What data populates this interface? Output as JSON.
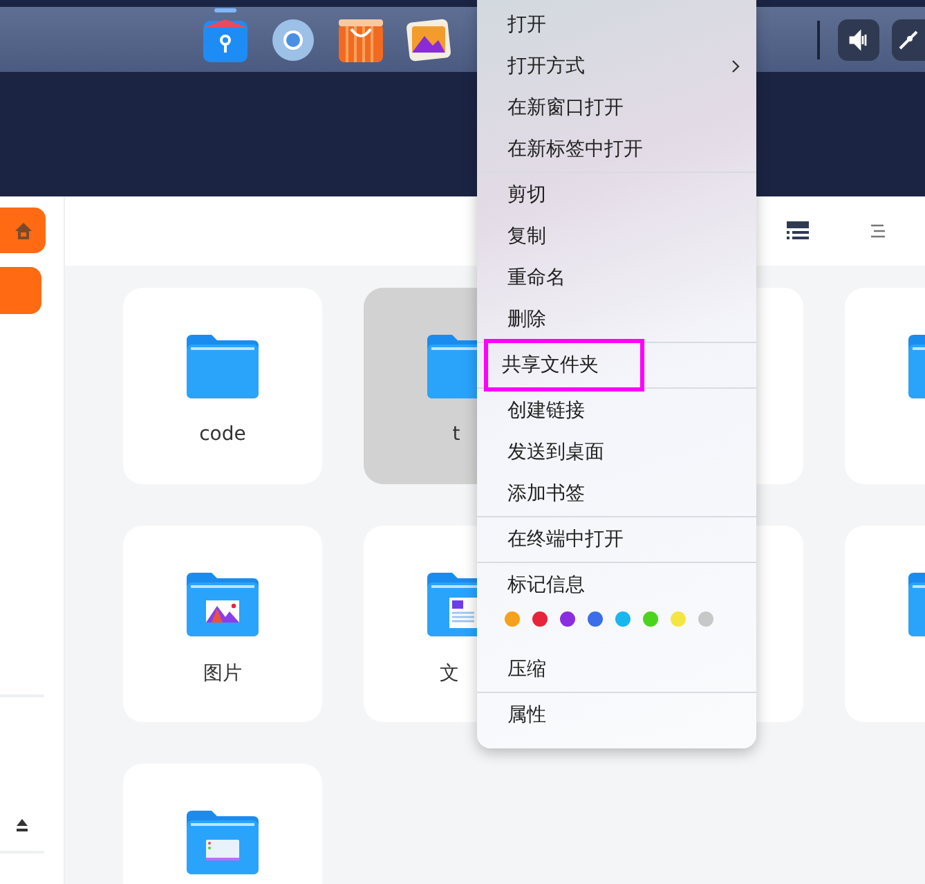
{
  "dock": {
    "apps": [
      {
        "kind": "files",
        "active": true
      },
      {
        "kind": "browser",
        "active": false
      },
      {
        "kind": "store",
        "active": false
      },
      {
        "kind": "photos",
        "active": false
      }
    ],
    "tray": [
      {
        "kind": "volume"
      },
      {
        "kind": "pen"
      }
    ]
  },
  "sidebar": {
    "buttons": [
      {
        "kind": "home"
      },
      {
        "kind": "blank"
      }
    ]
  },
  "toolbar": {
    "views": [
      {
        "kind": "detail",
        "selected": true
      },
      {
        "kind": "list",
        "selected": false
      }
    ]
  },
  "folders": [
    {
      "label": "code",
      "kind": "plain",
      "selected": false
    },
    {
      "label": "t",
      "kind": "plain",
      "selected": true
    },
    {
      "kind": "covered",
      "selected": false
    },
    {
      "kind": "plain",
      "selected": false
    },
    {
      "label": "图片",
      "kind": "pictures",
      "selected": false
    },
    {
      "label": "文",
      "kind": "documents",
      "selected": false
    },
    {
      "kind": "covered",
      "selected": false
    },
    {
      "kind": "plain",
      "selected": false
    },
    {
      "kind": "desktop",
      "selected": false
    }
  ],
  "context_menu": {
    "groups": [
      {
        "items": [
          {
            "kind": "item",
            "label": "打开"
          },
          {
            "kind": "submenu",
            "label": "打开方式"
          },
          {
            "kind": "item",
            "label": "在新窗口打开"
          },
          {
            "kind": "item",
            "label": "在新标签中打开"
          }
        ]
      },
      {
        "items": [
          {
            "kind": "item",
            "label": "剪切"
          },
          {
            "kind": "item",
            "label": "复制"
          },
          {
            "kind": "item",
            "label": "重命名"
          },
          {
            "kind": "item",
            "label": "删除"
          }
        ]
      },
      {
        "items": [
          {
            "kind": "item",
            "label": "共享文件夹",
            "highlighted": true
          }
        ]
      },
      {
        "items": [
          {
            "kind": "item",
            "label": "创建链接"
          },
          {
            "kind": "item",
            "label": "发送到桌面"
          },
          {
            "kind": "item",
            "label": "添加书签"
          }
        ]
      },
      {
        "items": [
          {
            "kind": "item",
            "label": "在终端中打开"
          }
        ]
      },
      {
        "items": [
          {
            "kind": "item",
            "label": "标记信息"
          },
          {
            "kind": "tags",
            "colors": [
              {
                "color": "#f5a11b"
              },
              {
                "color": "#e8243c"
              },
              {
                "color": "#8b2ee0"
              },
              {
                "color": "#3b6ee8"
              },
              {
                "color": "#1ab6f0"
              },
              {
                "color": "#4bd41b"
              },
              {
                "color": "#f5e542"
              },
              {
                "color": "#c8c8c8"
              }
            ]
          },
          {
            "kind": "item",
            "label": "压缩"
          }
        ]
      },
      {
        "items": [
          {
            "kind": "item",
            "label": "属性"
          }
        ]
      }
    ]
  }
}
